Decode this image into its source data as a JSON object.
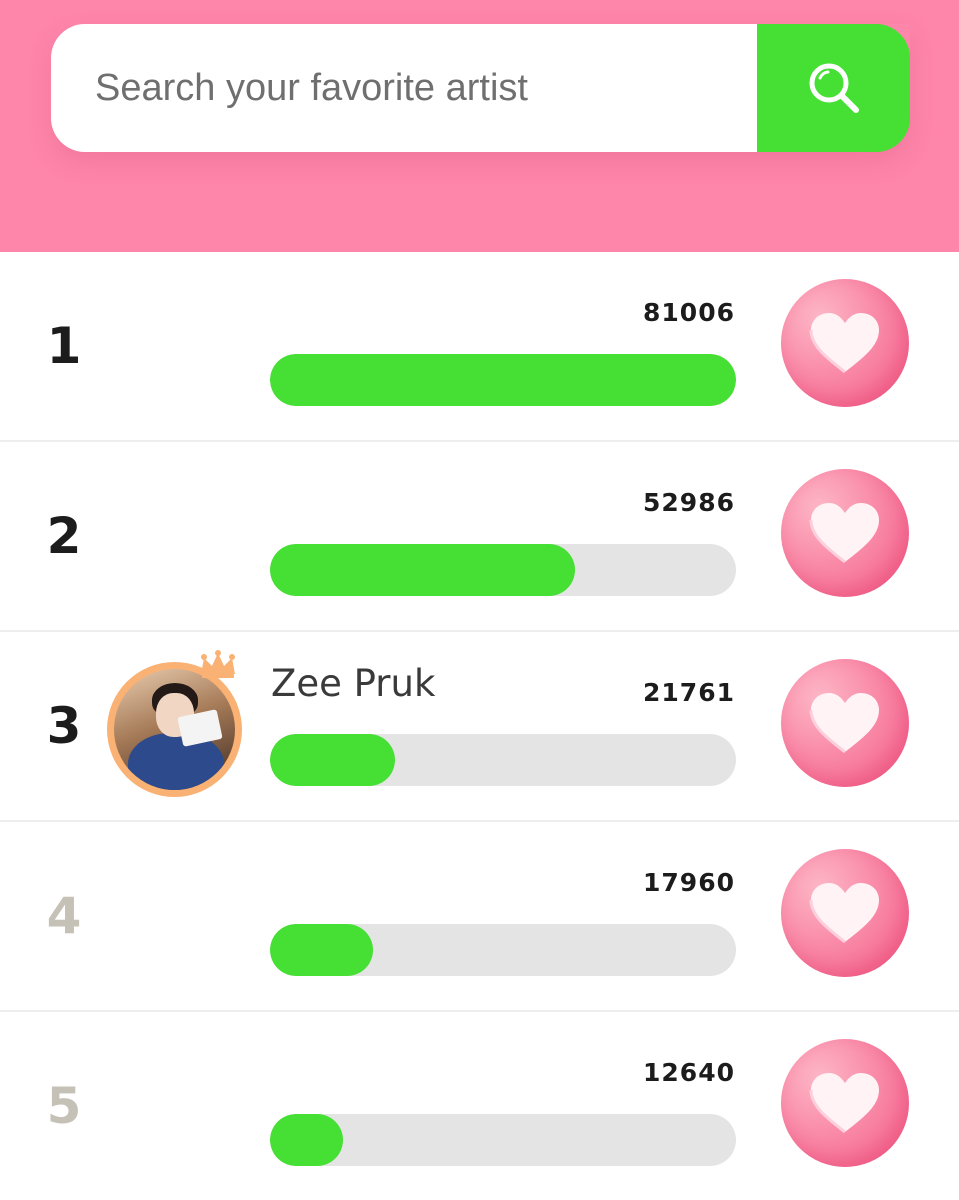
{
  "search": {
    "placeholder": "Search your favorite artist",
    "icon": "search-icon"
  },
  "colors": {
    "header_bg": "#fe86aa",
    "accent_green": "#46df34",
    "vote_pink": "#f45d88",
    "rank_dark": "#1c1c1c",
    "rank_faded": "#c5c1b6"
  },
  "ranking": [
    {
      "rank": "1",
      "name": "",
      "votes": "81006",
      "progress": 1.0,
      "faded": false,
      "avatar": false,
      "vote_icon": "heart-icon"
    },
    {
      "rank": "2",
      "name": "",
      "votes": "52986",
      "progress": 0.654,
      "faded": false,
      "avatar": false,
      "vote_icon": "heart-icon"
    },
    {
      "rank": "3",
      "name": "Zee Pruk",
      "votes": "21761",
      "progress": 0.268,
      "faded": false,
      "avatar": true,
      "vote_icon": "heart-icon"
    },
    {
      "rank": "4",
      "name": "",
      "votes": "17960",
      "progress": 0.222,
      "faded": true,
      "avatar": false,
      "vote_icon": "heart-icon"
    },
    {
      "rank": "5",
      "name": "",
      "votes": "12640",
      "progress": 0.156,
      "faded": true,
      "avatar": false,
      "vote_icon": "heart-icon"
    }
  ]
}
